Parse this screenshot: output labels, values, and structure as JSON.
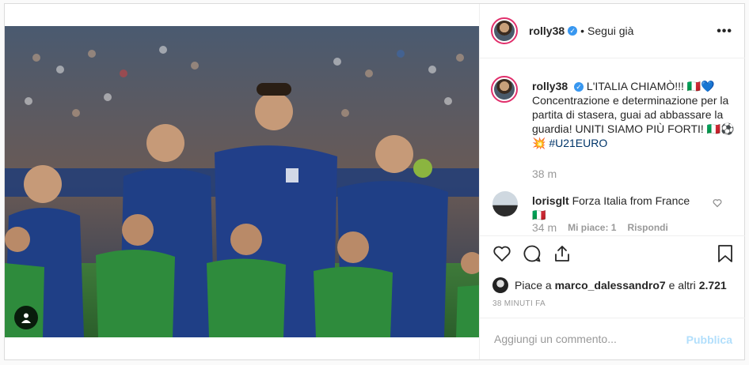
{
  "post": {
    "username": "rolly38",
    "verified_mark": "✓",
    "separator": "•",
    "follow_label": "Segui già",
    "more_label": "•••",
    "caption": {
      "text": "L'ITALIA CHIAMÒ!!! 🇮🇹💙 Concentrazione e determinazione per la partita di stasera, guai ad abbassare la guardia! UNITI SIAMO PIÙ FORTI! 🇮🇹⚽💥",
      "hashtag": "#U21EURO",
      "time": "38 m"
    },
    "comment": {
      "username": "lorisglt",
      "text": "Forza Italia from France 🇮🇹",
      "time": "34 m",
      "likes_label": "Mi piace: 1",
      "reply_label": "Rispondi"
    },
    "likes": {
      "prefix": "Piace a",
      "user": "marco_dalessandro7",
      "middle": "e altri",
      "count": "2.721"
    },
    "timestamp": "38 MINUTI FA",
    "add_comment_placeholder": "Aggiungi un commento...",
    "publish_label": "Pubblica"
  },
  "icons": {
    "like": "heart-icon",
    "comment": "comment-bubble-icon",
    "share": "share-icon",
    "save": "bookmark-icon",
    "tag": "person-tag-icon",
    "comment_like": "heart-icon"
  },
  "colors": {
    "link": "#003569",
    "verified": "#3897f0",
    "muted": "#999999",
    "publish_disabled": "#b2dffc",
    "story_ring": "#e1306c"
  }
}
